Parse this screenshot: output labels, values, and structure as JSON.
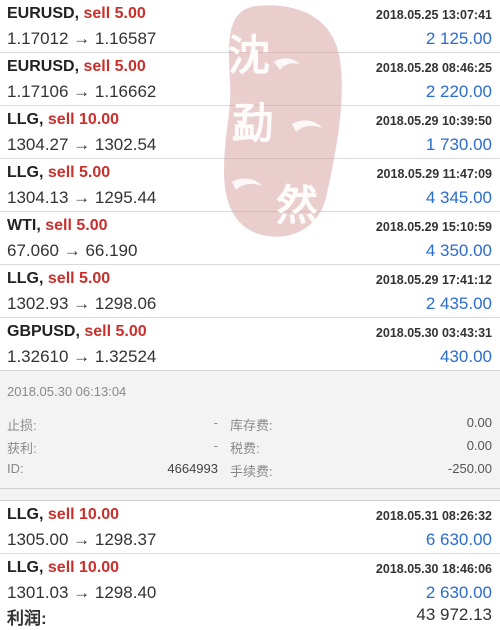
{
  "orders": [
    {
      "symbol": "EURUSD,",
      "side": "sell 5.00",
      "time": "2018.05.25 13:07:41",
      "prices": "1.17012 → 1.16587",
      "profit": "2 125.00"
    },
    {
      "symbol": "EURUSD,",
      "side": "sell 5.00",
      "time": "2018.05.28 08:46:25",
      "prices": "1.17106 → 1.16662",
      "profit": "2 220.00"
    },
    {
      "symbol": "LLG,",
      "side": "sell 10.00",
      "time": "2018.05.29 10:39:50",
      "prices": "1304.27 → 1302.54",
      "profit": "1 730.00"
    },
    {
      "symbol": "LLG,",
      "side": "sell 5.00",
      "time": "2018.05.29 11:47:09",
      "prices": "1304.13 → 1295.44",
      "profit": "4 345.00"
    },
    {
      "symbol": "WTI,",
      "side": "sell 5.00",
      "time": "2018.05.29 15:10:59",
      "prices": "67.060 → 66.190",
      "profit": "4 350.00"
    },
    {
      "symbol": "LLG,",
      "side": "sell 5.00",
      "time": "2018.05.29 17:41:12",
      "prices": "1302.93 → 1298.06",
      "profit": "2 435.00"
    },
    {
      "symbol": "GBPUSD,",
      "side": "sell 5.00",
      "time": "2018.05.30 03:43:31",
      "prices": "1.32610 → 1.32524",
      "profit": "430.00"
    }
  ],
  "details": {
    "time": "2018.05.30 06:13:04",
    "rows": [
      {
        "label": "止损:",
        "value": "-",
        "label2": "库存费:",
        "value2": "0.00"
      },
      {
        "label": "获利:",
        "value": "-",
        "label2": "税费:",
        "value2": "0.00"
      },
      {
        "label": "ID:",
        "value": "4664993",
        "label2": "手续费:",
        "value2": "-250.00"
      }
    ]
  },
  "orders_after": [
    {
      "symbol": "LLG,",
      "side": "sell 10.00",
      "time": "2018.05.31 08:26:32",
      "prices": "1305.00 → 1298.37",
      "profit": "6 630.00"
    },
    {
      "symbol": "LLG,",
      "side": "sell 10.00",
      "time": "2018.05.30 18:46:06",
      "prices": "1301.03 → 1298.40",
      "profit": "2 630.00"
    }
  ],
  "footer": {
    "label": "利润:",
    "value": "43 972.13"
  },
  "stamp": {
    "chars": [
      "沈",
      "勐",
      "然"
    ]
  },
  "colors": {
    "sell": "#c9302c",
    "profit": "#2b6cd0",
    "stamp": "#d9a6a6"
  }
}
